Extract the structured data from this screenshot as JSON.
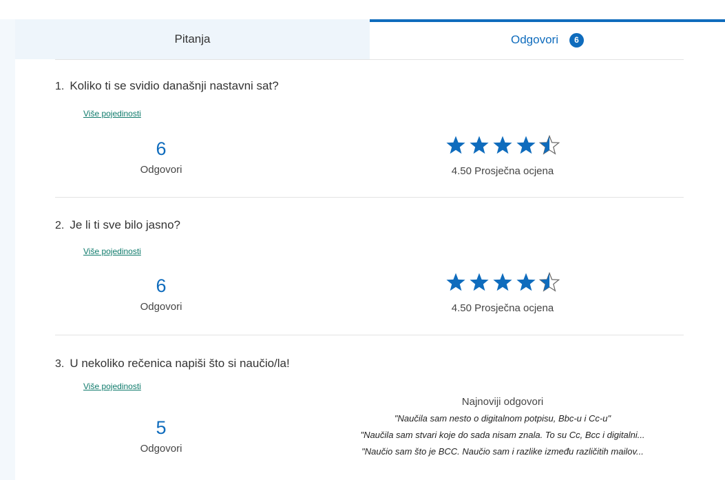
{
  "tabs": {
    "questions_label": "Pitanja",
    "responses_label": "Odgovori",
    "responses_count": "6"
  },
  "colors": {
    "accent": "#0f6cbd",
    "link": "#0e7a6b",
    "tab_inactive_bg": "#eef5fb"
  },
  "questions": [
    {
      "number": "1.",
      "title": "Koliko ti se svidio današnji nastavni sat?",
      "details_link": "Više pojedinosti",
      "response_count": "6",
      "response_label": "Odgovori",
      "rating": 4.5,
      "rating_text": "4.50 Prosječna ocjena",
      "star_icon": "star-icon"
    },
    {
      "number": "2.",
      "title": "Je li ti sve bilo jasno?",
      "details_link": "Više pojedinosti",
      "response_count": "6",
      "response_label": "Odgovori",
      "rating": 4.5,
      "rating_text": "4.50 Prosječna ocjena",
      "star_icon": "star-icon"
    },
    {
      "number": "3.",
      "title": "U nekoliko rečenica napiši što si naučio/la!",
      "details_link": "Više pojedinosti",
      "response_count": "5",
      "response_label": "Odgovori",
      "latest_title": "Najnoviji odgovori",
      "latest_responses": [
        "\"Naučila sam nesto o digitalnom potpisu, Bbc-u i Cc-u\"",
        "\"Naučila sam stvari koje do sada nisam znala. To su Cc, Bcc i digitalni...",
        "\"Naučio sam što je BCC. Naučio sam i razlike između različitih mailov..."
      ]
    }
  ]
}
